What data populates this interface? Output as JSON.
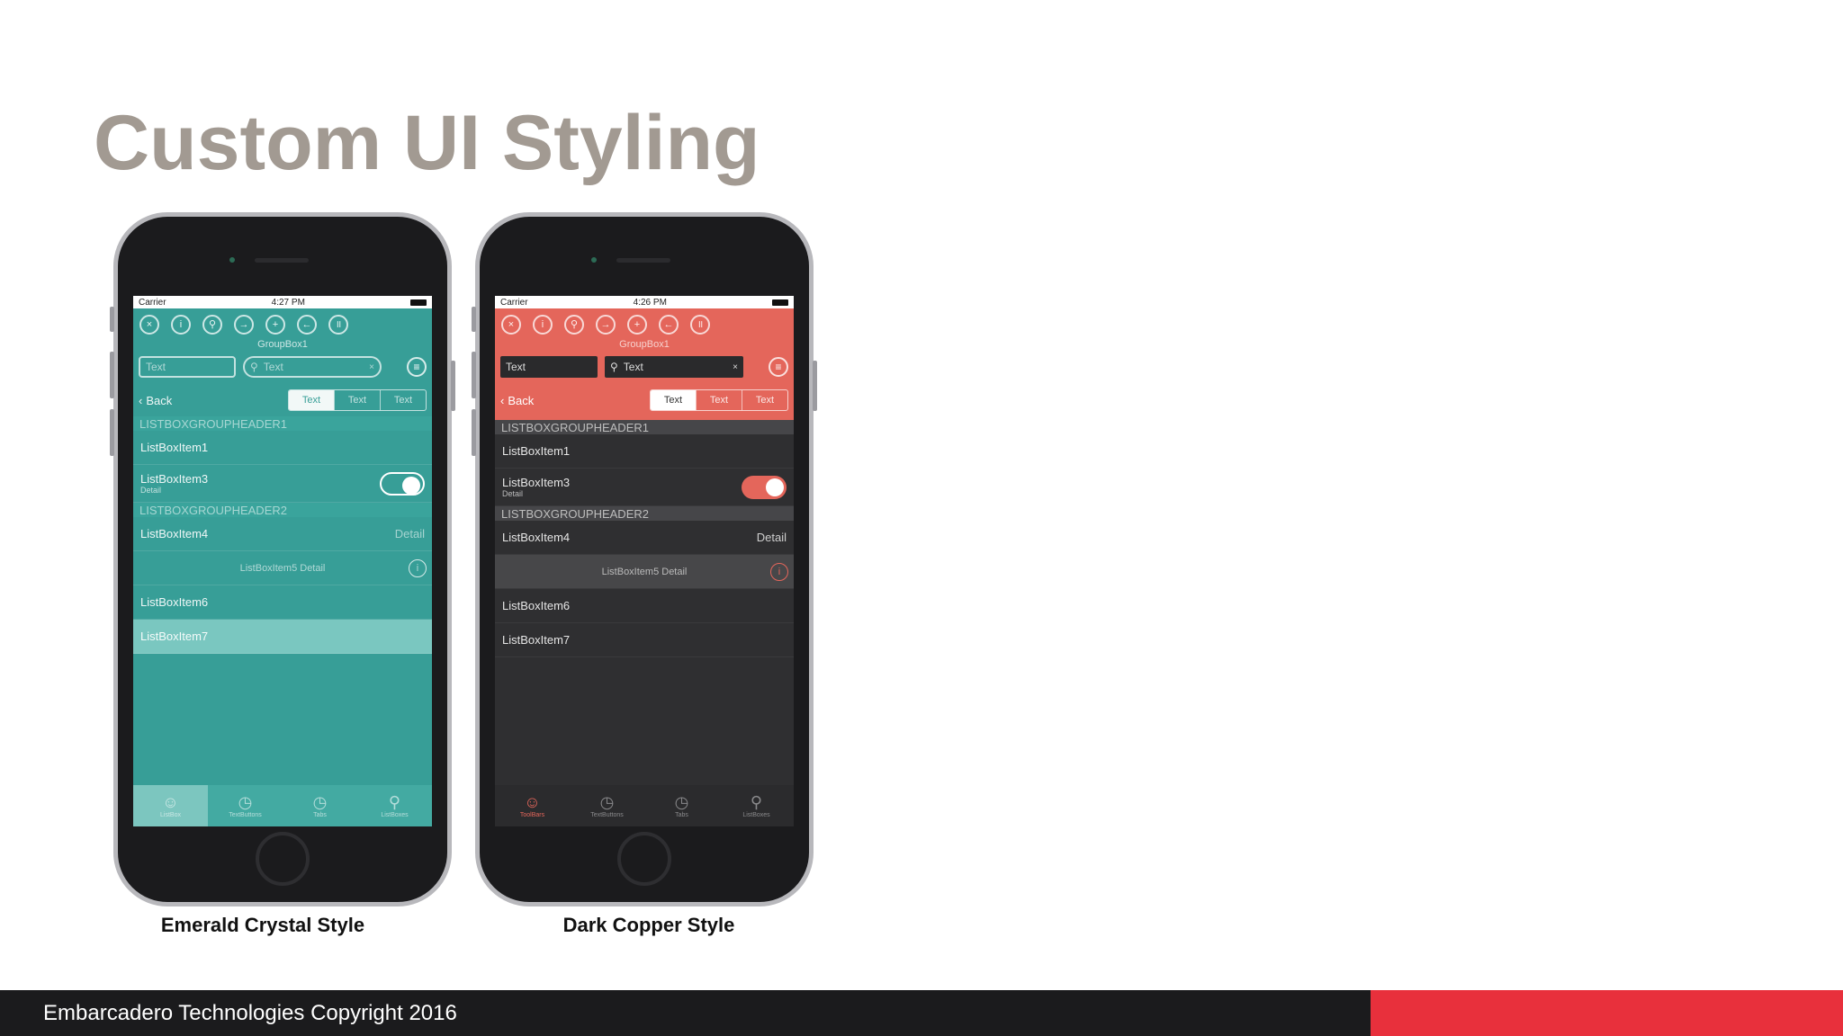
{
  "slide": {
    "title": "Custom UI Styling",
    "footer": "Embarcadero Technologies Copyright 2016",
    "colors": {
      "title": "#a29a92",
      "accent": "#e8303c",
      "footer_bg": "#1b1b1d"
    }
  },
  "phones": [
    {
      "caption": "Emerald Crystal Style",
      "accent": "#379e97",
      "status": {
        "carrier": "Carrier",
        "time": "4:27 PM"
      },
      "icons": [
        "close-circle-icon",
        "info-icon",
        "search-icon",
        "forward-icon",
        "add-icon",
        "back-icon",
        "pause-icon"
      ],
      "groupbox": "GroupBox1",
      "text_input": "Text",
      "search_input": "Text",
      "back": "Back",
      "segments": [
        "Text",
        "Text",
        "Text"
      ],
      "list": {
        "header1": "LISTBOXGROUPHEADER1",
        "item1": "ListBoxItem1",
        "item3": "ListBoxItem3",
        "item3_detail": "Detail",
        "header2": "LISTBOXGROUPHEADER2",
        "item4": "ListBoxItem4",
        "item4_detail": "Detail",
        "item5": "ListBoxItem5 Detail",
        "item6": "ListBoxItem6",
        "item7": "ListBoxItem7"
      },
      "tabs": [
        "ListBox",
        "TextButtons",
        "Tabs",
        "ListBoxes"
      ]
    },
    {
      "caption": "Dark Copper Style",
      "accent": "#e4665b",
      "status": {
        "carrier": "Carrier",
        "time": "4:26 PM"
      },
      "icons": [
        "close-circle-icon",
        "info-icon",
        "search-icon",
        "forward-icon",
        "add-icon",
        "back-icon",
        "pause-icon"
      ],
      "groupbox": "GroupBox1",
      "text_input": "Text",
      "search_input": "Text",
      "back": "Back",
      "segments": [
        "Text",
        "Text",
        "Text"
      ],
      "list": {
        "header1": "LISTBOXGROUPHEADER1",
        "item1": "ListBoxItem1",
        "item3": "ListBoxItem3",
        "item3_detail": "Detail",
        "header2": "LISTBOXGROUPHEADER2",
        "item4": "ListBoxItem4",
        "item4_detail": "Detail",
        "item5": "ListBoxItem5 Detail",
        "item6": "ListBoxItem6",
        "item7": "ListBoxItem7"
      },
      "tabs": [
        "ToolBars",
        "TextButtons",
        "Tabs",
        "ListBoxes"
      ]
    }
  ]
}
